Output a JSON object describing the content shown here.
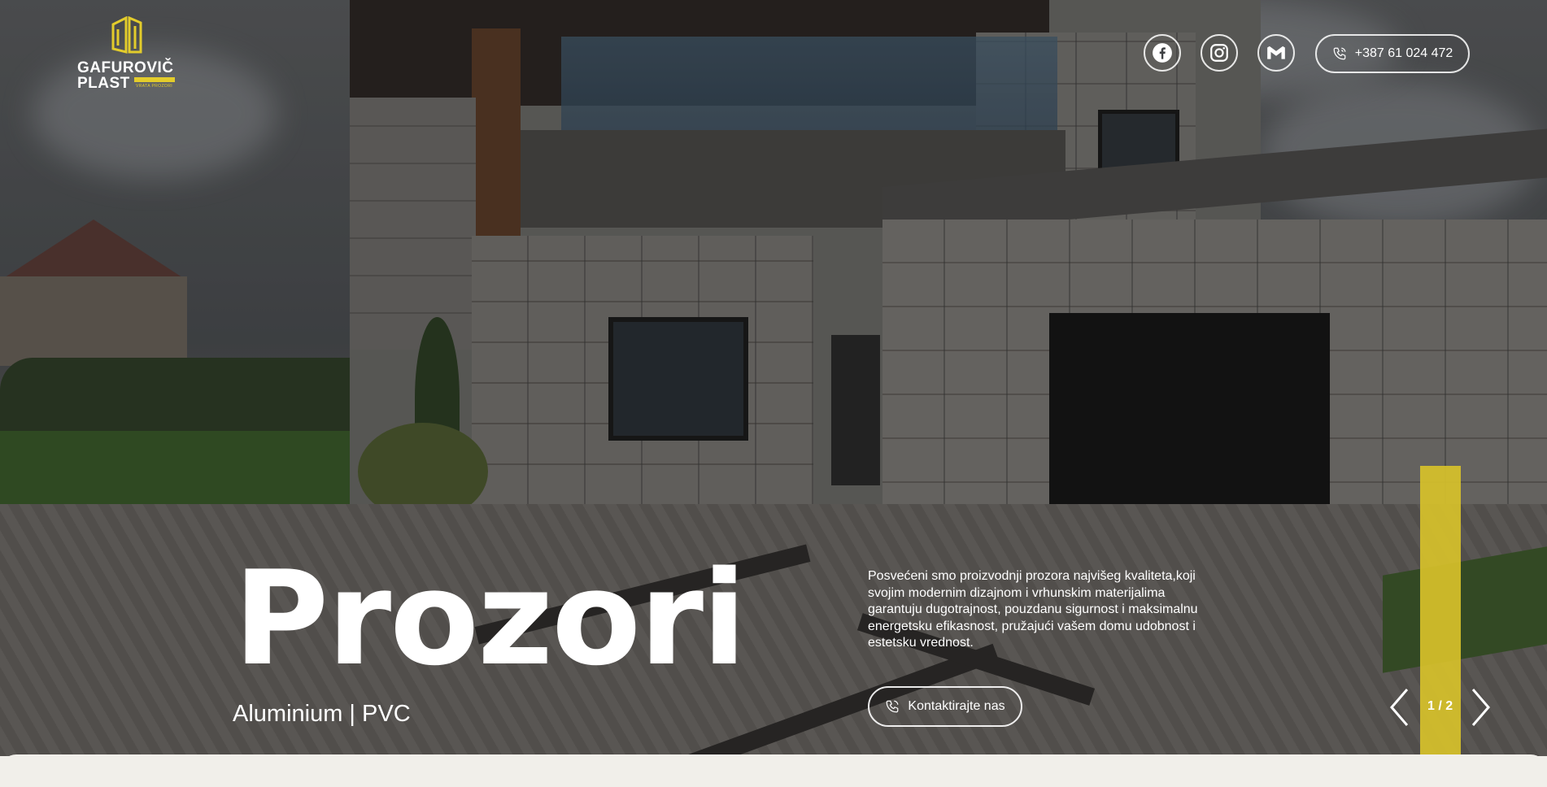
{
  "brand": {
    "name_line1": "GAFUROVIČ",
    "name_line2": "PLAST",
    "tagline": "VRATA PROZORI",
    "accent_color": "#d7c12a"
  },
  "header": {
    "social": [
      {
        "name": "facebook",
        "icon": "facebook-icon"
      },
      {
        "name": "instagram",
        "icon": "instagram-icon"
      },
      {
        "name": "gmail",
        "icon": "mail-icon"
      }
    ],
    "phone": "+387 61 024 472"
  },
  "hero": {
    "title": "Prozori",
    "subtitle": "Aluminium | PVC",
    "description": "Posvećeni smo proizvodnji prozora najvišeg kvaliteta,koji svojim modernim dizajnom i vrhunskim materijalima garantuju dugotrajnost, pouzdanu sigurnost i maksimalnu energetsku efikasnost, pružajući vašem domu udobnost i estetsku vrednost.",
    "cta_label": "Kontaktirajte nas"
  },
  "slider": {
    "counter": "1 / 2",
    "prev_icon": "chevron-left-icon",
    "next_icon": "chevron-right-icon"
  }
}
